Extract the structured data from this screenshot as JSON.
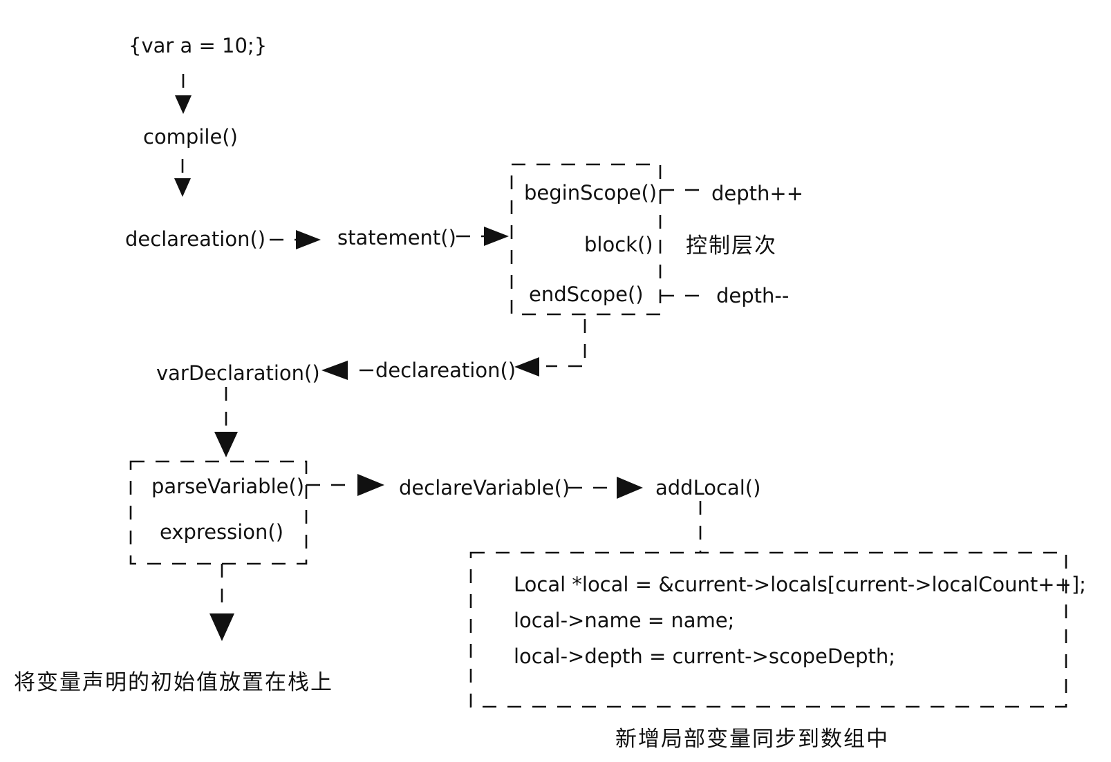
{
  "nodes": {
    "source_code": "{var a = 10;}",
    "compile": "compile()",
    "declaration_1": "declareation()",
    "statement": "statement()",
    "begin_scope": "beginScope()",
    "block": "block()",
    "end_scope": "endScope()",
    "depth_inc": "depth++",
    "depth_dec": "depth--",
    "scope_note": "控制层次",
    "declaration_2": "declareation()",
    "var_declaration": "varDeclaration()",
    "parse_variable": "parseVariable()",
    "expression": "expression()",
    "declare_variable": "declareVariable()",
    "add_local": "addLocal()",
    "stack_note": "将变量声明的初始值放置在栈上",
    "sync_note": "新增局部变量同步到数组中"
  },
  "code_block": {
    "lines": [
      "Local *local = &current->locals[current->localCount++];",
      "local->name = name;",
      "local->depth = current->scopeDepth;"
    ]
  }
}
